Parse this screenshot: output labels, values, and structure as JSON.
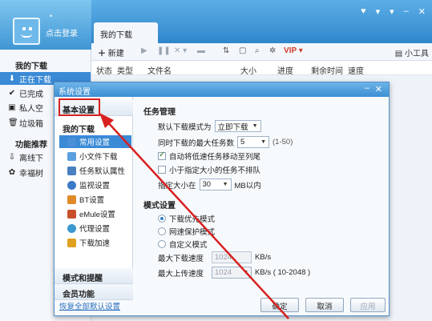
{
  "app": {
    "login_text": "点击登录",
    "login_dot": "•",
    "active_tab": "我的下载",
    "window_controls": [
      "♥",
      "▾",
      "▾",
      "–",
      "✕"
    ]
  },
  "left_panel": {
    "section_my_downloads": "我的下载",
    "items": [
      {
        "label": "正在下载",
        "icon": "download-icon",
        "glyph": "⬇",
        "selected": true
      },
      {
        "label": "已完成",
        "icon": "check-icon",
        "glyph": "✔",
        "selected": false
      },
      {
        "label": "私人空",
        "icon": "lock-icon",
        "glyph": "▣",
        "selected": false
      },
      {
        "label": "垃圾箱",
        "icon": "trash-icon",
        "glyph": "🗑",
        "selected": false
      }
    ],
    "section_recommend": "功能推荐",
    "rec_items": [
      {
        "label": "离线下",
        "icon": "offline-icon",
        "glyph": "⇩"
      },
      {
        "label": "幸福树",
        "icon": "tree-icon",
        "glyph": "✿"
      }
    ]
  },
  "toolbar": {
    "new_label": "新建",
    "right_tool": "小工具"
  },
  "columns": [
    "状态",
    "类型",
    "文件名",
    "大小",
    "进度",
    "剩余时间",
    "速度"
  ],
  "dialog": {
    "title": "系统设置",
    "nav": {
      "basic": "基本设置",
      "my_downloads": "我的下载",
      "items": [
        {
          "label": "常用设置",
          "icon": "gear-icon",
          "color": "#4a90d9",
          "selected": true
        },
        {
          "label": "小文件下载",
          "icon": "file-icon",
          "color": "#5aa0e0",
          "selected": false
        },
        {
          "label": "任务默认属性",
          "icon": "task-icon",
          "color": "#4a80c0",
          "selected": false
        },
        {
          "label": "监视设置",
          "icon": "monitor-icon",
          "color": "#3a7ac8",
          "selected": false
        },
        {
          "label": "BT设置",
          "icon": "bt-icon",
          "color": "#e08a2a",
          "selected": false
        },
        {
          "label": "eMule设置",
          "icon": "emule-icon",
          "color": "#c8502a",
          "selected": false
        },
        {
          "label": "代理设置",
          "icon": "proxy-icon",
          "color": "#3a9ad0",
          "selected": false
        },
        {
          "label": "下载加速",
          "icon": "accelerate-icon",
          "color": "#e0a020",
          "selected": false
        }
      ],
      "mode": "模式和提醒",
      "member": "会员功能",
      "restore": "恢复全部默认设置"
    },
    "content": {
      "task_mgmt": "任务管理",
      "default_mode_label": "默认下载模式为",
      "default_mode_value": "立即下载",
      "max_tasks_label": "同时下载的最大任务数",
      "max_tasks_value": "5",
      "max_tasks_range": "(1-50)",
      "auto_move_label": "自动将低速任务移动至列尾",
      "auto_move_checked": true,
      "small_queue_label": "小于指定大小的任务不排队",
      "small_queue_checked": false,
      "size_label": "指定大小在",
      "size_value": "30",
      "size_unit": "MB以内",
      "mode_settings": "模式设置",
      "mode_options": [
        {
          "label": "下载优先模式",
          "selected": true
        },
        {
          "label": "网速保护模式",
          "selected": false
        },
        {
          "label": "自定义模式",
          "selected": false
        }
      ],
      "max_down_label": "最大下载速度",
      "max_down_value": "1024",
      "max_down_unit": "KB/s",
      "max_up_label": "最大上传速度",
      "max_up_value": "1024",
      "max_up_unit": "KB/s ( 10-2048 )"
    },
    "buttons": {
      "ok": "确定",
      "cancel": "取消",
      "apply": "应用"
    }
  },
  "annotation": {
    "arrow_color": "#d82020"
  }
}
